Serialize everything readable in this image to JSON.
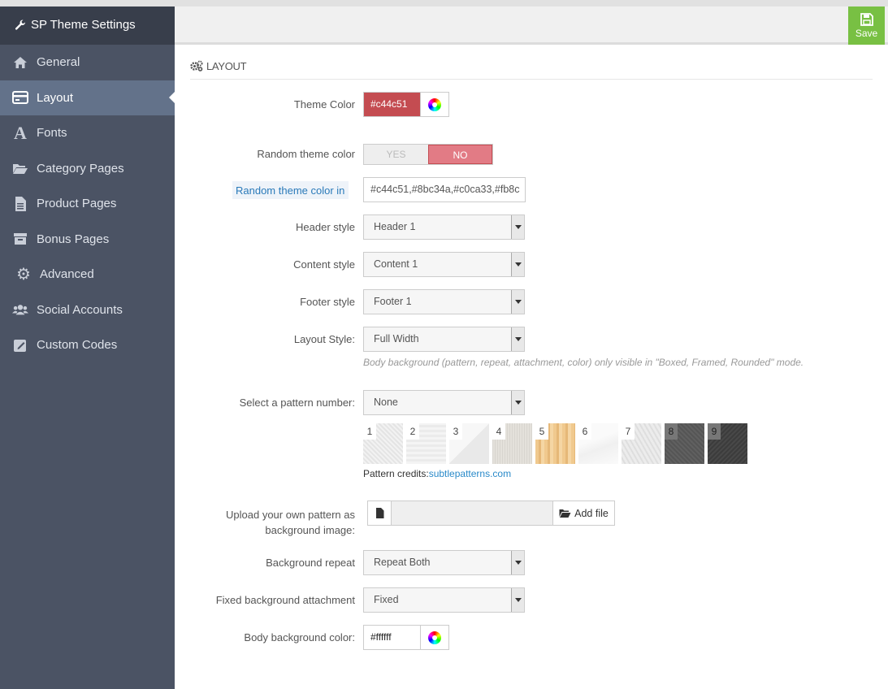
{
  "app": {
    "title": "SP Theme Settings"
  },
  "sidebar": {
    "items": [
      {
        "label": "General",
        "icon": "home-icon"
      },
      {
        "label": "Layout",
        "icon": "layout-icon",
        "active": true
      },
      {
        "label": "Fonts",
        "icon": "font-icon"
      },
      {
        "label": "Category Pages",
        "icon": "folder-open-icon"
      },
      {
        "label": "Product Pages",
        "icon": "file-icon"
      },
      {
        "label": "Bonus Pages",
        "icon": "archive-icon"
      },
      {
        "label": "Advanced",
        "icon": "gear-icon"
      },
      {
        "label": "Social Accounts",
        "icon": "users-icon"
      },
      {
        "label": "Custom Codes",
        "icon": "edit-icon"
      }
    ]
  },
  "toolbar": {
    "save_label": "Save"
  },
  "panel": {
    "title": "LAYOUT"
  },
  "colors": {
    "theme": "#c44c51",
    "toggle_no": "#e27b85",
    "save": "#78c043",
    "sidebar": "#4b5364"
  },
  "form": {
    "theme_color": {
      "label": "Theme Color",
      "value": "#c44c51"
    },
    "random_theme_color": {
      "label": "Random theme color",
      "yes": "YES",
      "no": "NO",
      "selected": "NO"
    },
    "random_theme_color_in": {
      "label": "Random theme color in",
      "value": "#c44c51,#8bc34a,#c0ca33,#fb8c"
    },
    "header_style": {
      "label": "Header style",
      "value": "Header 1"
    },
    "content_style": {
      "label": "Content style",
      "value": "Content 1"
    },
    "footer_style": {
      "label": "Footer style",
      "value": "Footer 1"
    },
    "layout_style": {
      "label": "Layout Style:",
      "value": "Full Width",
      "hint": "Body background (pattern, repeat, attachment, color) only visible in \"Boxed, Framed, Rounded\" mode."
    },
    "pattern_number": {
      "label": "Select a pattern number:",
      "value": "None"
    },
    "patterns": [
      "1",
      "2",
      "3",
      "4",
      "5",
      "6",
      "7",
      "8",
      "9"
    ],
    "pattern_credits": {
      "text": "Pattern credits:",
      "link": "subtlepatterns.com"
    },
    "upload": {
      "label_line1": "Upload your own pattern as",
      "label_line2": "background image:",
      "button": "Add file"
    },
    "background_repeat": {
      "label": "Background repeat",
      "value": "Repeat Both"
    },
    "fixed_attachment": {
      "label": "Fixed background attachment",
      "value": "Fixed"
    },
    "body_bg_color": {
      "label": "Body background color:",
      "value": "#ffffff"
    }
  }
}
